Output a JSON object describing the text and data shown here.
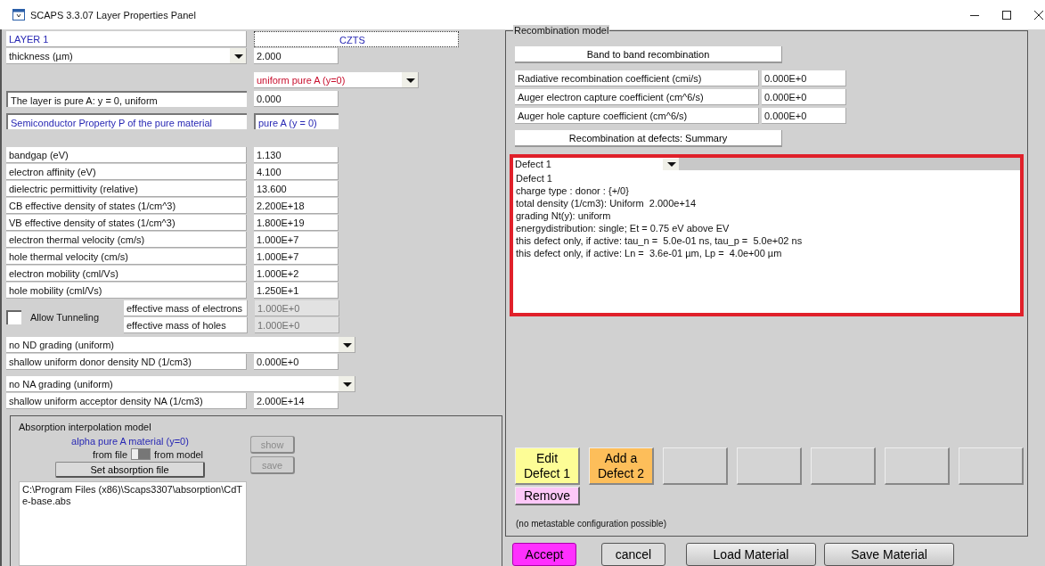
{
  "window": {
    "title": "SCAPS 3.3.07 Layer Properties Panel"
  },
  "layer": {
    "name": "LAYER 1",
    "material": "CZTS"
  },
  "thickness": {
    "label": "thickness (µm)",
    "value": "2.000"
  },
  "composition": {
    "label": "uniform pure A (y=0)"
  },
  "pure_row": {
    "label": "The layer is pure A: y = 0, uniform",
    "value": "0.000"
  },
  "property_row": {
    "label": "Semiconductor Property P of the pure material",
    "value": "pure A (y = 0)"
  },
  "parameters": [
    {
      "label": "bandgap (eV)",
      "value": "1.130"
    },
    {
      "label": "electron affinity (eV)",
      "value": "4.100"
    },
    {
      "label": "dielectric permittivity (relative)",
      "value": "13.600"
    },
    {
      "label": "CB effective density of states (1/cm^3)",
      "value": "2.200E+18"
    },
    {
      "label": "VB effective density of states (1/cm^3)",
      "value": "1.800E+19"
    },
    {
      "label": "electron thermal velocity (cm/s)",
      "value": "1.000E+7"
    },
    {
      "label": "hole thermal velocity (cm/s)",
      "value": "1.000E+7"
    },
    {
      "label": "electron mobility (cml/Vs)",
      "value": "1.000E+2"
    },
    {
      "label": "hole mobility (cml/Vs)",
      "value": "1.250E+1"
    }
  ],
  "tunneling": {
    "label": "Allow Tunneling",
    "checked": false,
    "masses": [
      {
        "label": "effective mass of electrons",
        "value": "1.000E+0",
        "disabled": true
      },
      {
        "label": "effective mass of holes",
        "value": "1.000E+0",
        "disabled": true
      }
    ]
  },
  "donor": {
    "grading": "no ND grading (uniform)",
    "label": "shallow uniform donor density ND (1/cm3)",
    "value": "0.000E+0"
  },
  "acceptor": {
    "grading": "no NA grading (uniform)",
    "label": "shallow uniform acceptor density NA (1/cm3)",
    "value": "2.000E+14"
  },
  "absorption": {
    "title": "Absorption interpolation model",
    "subtitle": "alpha pure A material (y=0)",
    "from_file": "from file",
    "from_model": "from model",
    "switch_on": true,
    "set_button": "Set absorption file",
    "show_button": {
      "label": "show",
      "disabled": true
    },
    "save_button": {
      "label": "save",
      "disabled": true
    },
    "file_path": "C:\\Program Files (x86)\\Scaps3307\\absorption\\CdTe-base.abs"
  },
  "recombination": {
    "title": "Recombination model",
    "band_button": "Band to band recombination",
    "coefficients": [
      {
        "label": "Radiative recombination coefficient (cmi/s)",
        "value": "0.000E+0"
      },
      {
        "label": "Auger electron capture coefficient (cm^6/s)",
        "value": "0.000E+0"
      },
      {
        "label": "Auger hole capture coefficient (cm^6/s)",
        "value": "0.000E+0"
      }
    ],
    "defects_button": "Recombination at defects: Summary",
    "defect_select": "Defect 1",
    "defect_details": [
      "Defect 1",
      "charge type : donor : {+/0}",
      "total density (1/cm3): Uniform  2.000e+14",
      "grading Nt(y): uniform",
      "energydistribution: single; Et = 0.75 eV above EV",
      "this defect only, if active: tau_n =  5.0e-01 ns, tau_p =  5.0e+02 ns",
      "this defect only, if active: Ln =  3.6e-01 µm, Lp =  4.0e+00 µm"
    ],
    "defect_slots": [
      {
        "kind": "edit",
        "lines": [
          "Edit",
          "Defect 1"
        ]
      },
      {
        "kind": "add",
        "lines": [
          "Add a",
          "Defect 2"
        ]
      },
      {
        "kind": "empty"
      },
      {
        "kind": "empty"
      },
      {
        "kind": "empty"
      },
      {
        "kind": "empty"
      },
      {
        "kind": "empty"
      }
    ],
    "remove_button": "Remove",
    "note": "(no metastable configuration possible)"
  },
  "buttons": [
    {
      "kind": "accept",
      "label": "Accept"
    },
    {
      "kind": "cancel",
      "label": "cancel"
    },
    {
      "kind": "load",
      "label": "Load Material"
    },
    {
      "kind": "save",
      "label": "Save Material"
    }
  ]
}
